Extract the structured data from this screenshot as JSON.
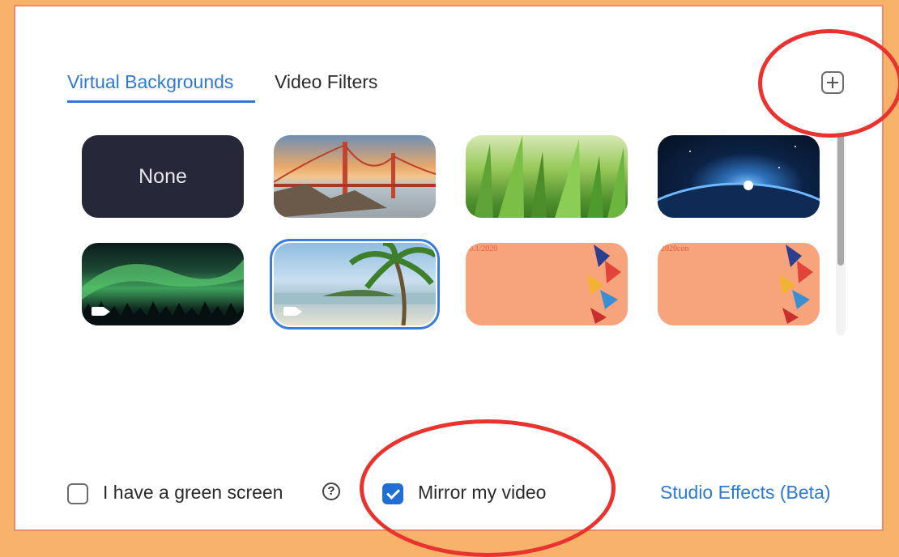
{
  "tabs": [
    {
      "label": "Virtual Backgrounds",
      "active": true
    },
    {
      "label": "Video Filters",
      "active": false
    }
  ],
  "add_button": {
    "icon": "plus-icon"
  },
  "backgrounds": [
    {
      "label": "None",
      "type": "none"
    },
    {
      "name": "golden-gate-bridge"
    },
    {
      "name": "grass"
    },
    {
      "name": "earth-from-space"
    },
    {
      "name": "aurora",
      "has_video": true
    },
    {
      "name": "beach-palm",
      "has_video": true,
      "selected": true
    },
    {
      "name": "zoom-2020-orange-1",
      "caption": "0.1/2020"
    },
    {
      "name": "zoom-2020-orange-2",
      "caption": "2020con"
    }
  ],
  "options": {
    "green_screen_label": "I have a green screen",
    "green_screen_checked": false,
    "mirror_label": "Mirror my video",
    "mirror_checked": true,
    "studio_effects_label": "Studio Effects (Beta)"
  },
  "colors": {
    "accent": "#2d7ad6",
    "highlight_ring": "#e8332f",
    "page_background": "#f7b26a"
  }
}
